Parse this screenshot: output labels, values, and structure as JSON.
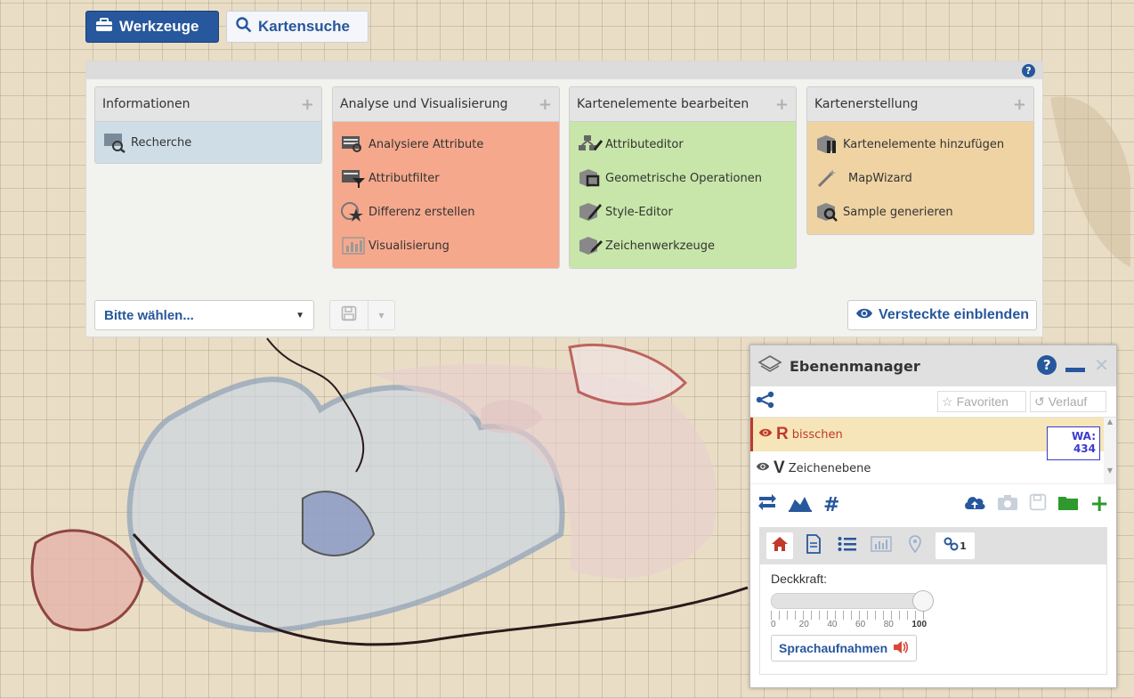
{
  "top_buttons": {
    "tools": "Werkzeuge",
    "search": "Kartensuche"
  },
  "panel": {
    "columns": [
      {
        "title": "Informationen",
        "items": [
          "Recherche"
        ]
      },
      {
        "title": "Analyse und Visualisierung",
        "items": [
          "Analysiere Attribute",
          "Attributfilter",
          "Differenz erstellen",
          "Visualisierung"
        ]
      },
      {
        "title": "Kartenelemente bearbeiten",
        "items": [
          "Attributeditor",
          "Geometrische Operationen",
          "Style-Editor",
          "Zeichenwerkzeuge"
        ]
      },
      {
        "title": "Kartenerstellung",
        "items": [
          "Kartenelemente hinzufügen",
          "MapWizard",
          "Sample generieren"
        ]
      }
    ],
    "select_value": "Bitte wählen...",
    "show_hidden": "Versteckte einblenden"
  },
  "layer_manager": {
    "title": "Ebenenmanager",
    "favorites": "Favoriten",
    "history": "Verlauf",
    "layers": [
      {
        "type": "R",
        "name": "bisschen"
      },
      {
        "type": "V",
        "name": "Zeichenebene"
      }
    ],
    "wa_label": "WA:",
    "wa_value": "434",
    "link_count": "1",
    "opacity_label": "Deckkraft:",
    "opacity_ticks": [
      "0",
      "20",
      "40",
      "60",
      "80",
      "100"
    ],
    "opacity_value": 1.0,
    "voice_button": "Sprachaufnahmen"
  },
  "colors": {
    "accent": "#27579c",
    "info": "#cfdde6",
    "analysis": "#f6a88c",
    "edit": "#c8e6a9",
    "create": "#efd3a3",
    "green": "#2e9a2e",
    "red": "#c0392b"
  }
}
